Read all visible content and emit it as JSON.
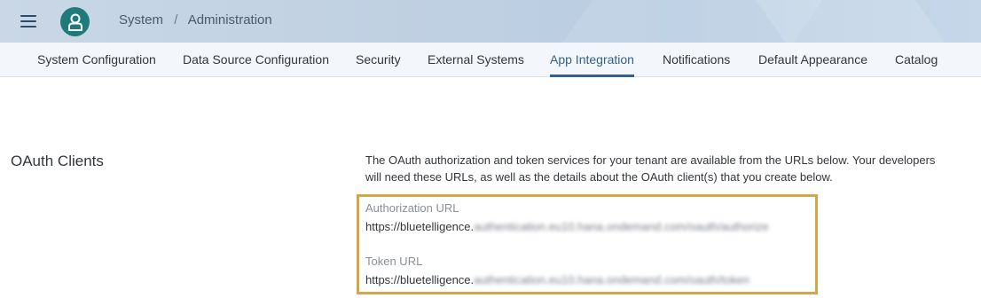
{
  "header": {
    "menu_icon": "hamburger-menu-icon",
    "avatar_icon": "user-avatar-icon",
    "breadcrumb": {
      "system": "System",
      "separator": "/",
      "current": "Administration"
    }
  },
  "tabs": [
    {
      "label": "System Configuration",
      "active": false
    },
    {
      "label": "Data Source Configuration",
      "active": false
    },
    {
      "label": "Security",
      "active": false
    },
    {
      "label": "External Systems",
      "active": false
    },
    {
      "label": "App Integration",
      "active": true
    },
    {
      "label": "Notifications",
      "active": false
    },
    {
      "label": "Default Appearance",
      "active": false
    },
    {
      "label": "Catalog",
      "active": false
    }
  ],
  "oauth": {
    "title": "OAuth Clients",
    "description": "The OAuth authorization and token services for your tenant are available from the URLs below. Your developers will need these URLs, as well as the details about the OAuth client(s) that you create below.",
    "authorization_label": "Authorization URL",
    "authorization_prefix": "https://bluetelligence.",
    "authorization_blurred": "authentication.eu10.hana.ondemand.com/oauth/authorize",
    "token_label": "Token URL",
    "token_prefix": "https://bluetelligence.",
    "token_blurred": "authentication.eu10.hana.ondemand.com/oauth/token"
  },
  "colors": {
    "accent": "#346187",
    "highlight_border": "#d4a647",
    "avatar": "#1f7a7a"
  }
}
